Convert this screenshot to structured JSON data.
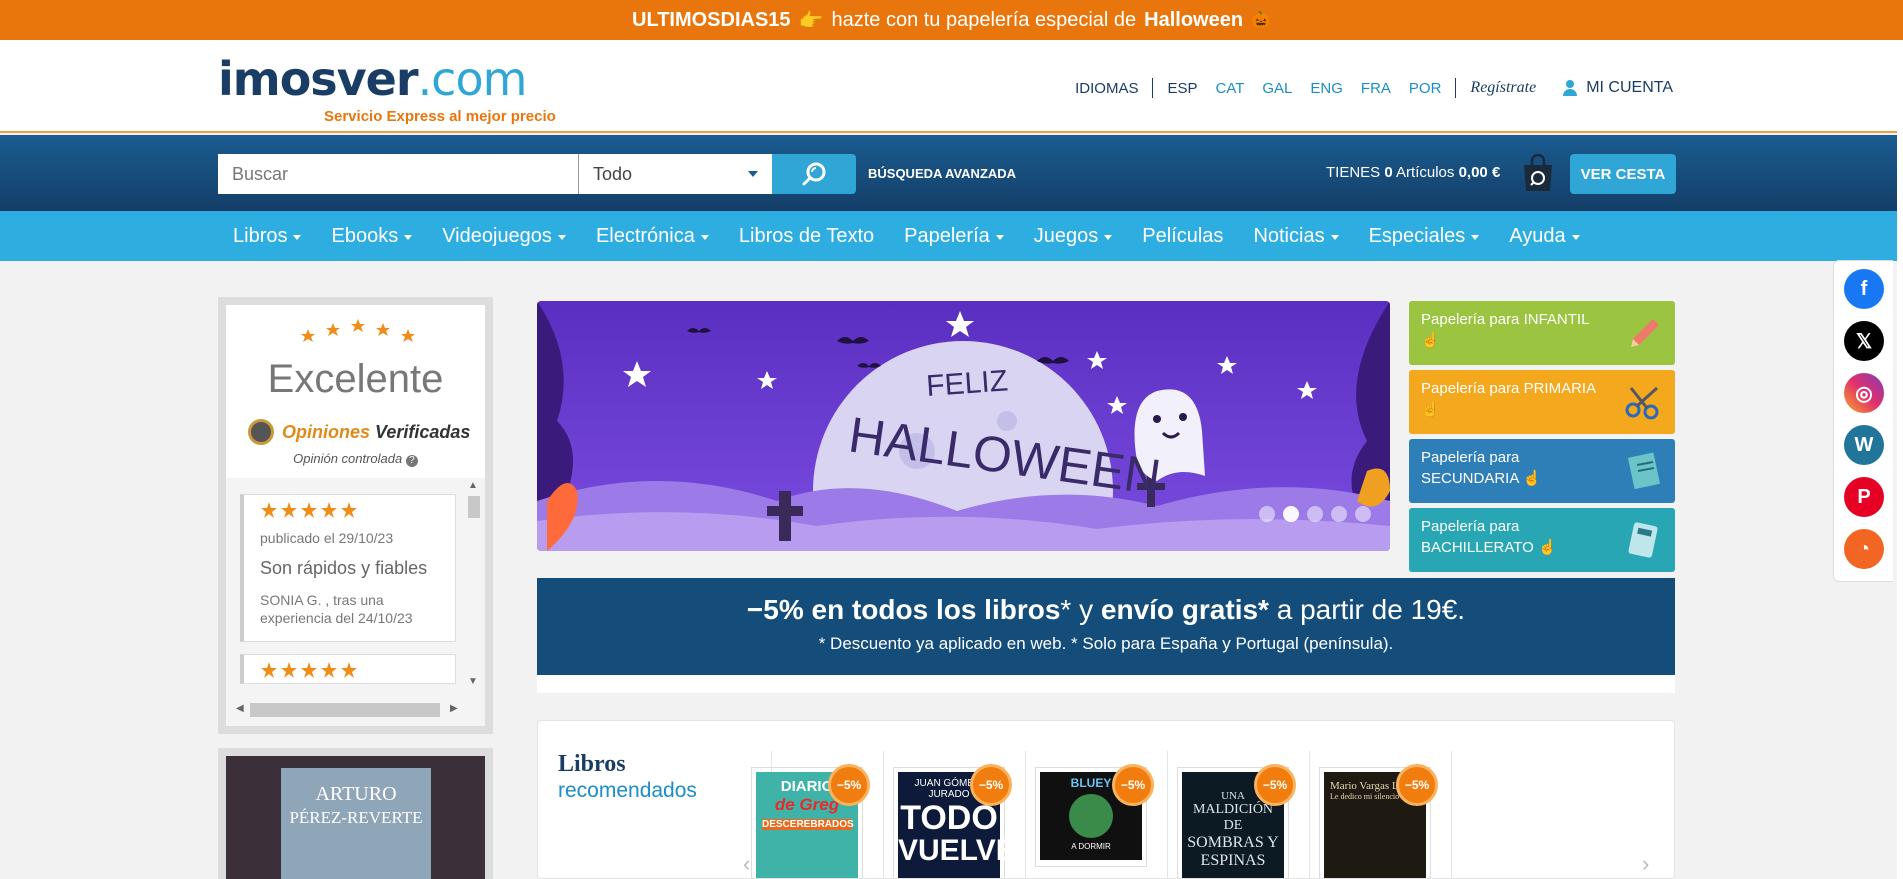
{
  "promo": {
    "code": "ULTIMOSDIAS15",
    "hand": "👉",
    "text": "hazte con tu papelería especial de",
    "highlight": "Halloween",
    "emoji": "🎃"
  },
  "header": {
    "logo_main": "imosver",
    "logo_tld": ".com",
    "logo_tagline": "Servicio Express al mejor precio",
    "languages_label": "IDIOMAS",
    "languages": [
      "ESP",
      "CAT",
      "GAL",
      "ENG",
      "FRA",
      "POR"
    ],
    "register": "Regístrate",
    "account": "MI CUENTA"
  },
  "search": {
    "placeholder": "Buscar",
    "category": "Todo",
    "advanced": "BÚSQUEDA AVANZADA",
    "cart_prefix": "TIENES",
    "cart_count": "0",
    "cart_items_label": "Artículos",
    "cart_total": "0,00 €",
    "cart_button": "VER CESTA"
  },
  "nav": [
    {
      "label": "Libros",
      "dropdown": true
    },
    {
      "label": "Ebooks",
      "dropdown": true
    },
    {
      "label": "Videojuegos",
      "dropdown": true
    },
    {
      "label": "Electrónica",
      "dropdown": true
    },
    {
      "label": "Libros de Texto",
      "dropdown": false
    },
    {
      "label": "Papelería",
      "dropdown": true
    },
    {
      "label": "Juegos",
      "dropdown": true
    },
    {
      "label": "Películas",
      "dropdown": false
    },
    {
      "label": "Noticias",
      "dropdown": true
    },
    {
      "label": "Especiales",
      "dropdown": true
    },
    {
      "label": "Ayuda",
      "dropdown": true
    }
  ],
  "reviews": {
    "rating_label": "Excelente",
    "brand_a": "Opiniones",
    "brand_b": "Verificadas",
    "controlled": "Opinión controlada",
    "stars": 5,
    "card": {
      "date": "publicado el 29/10/23",
      "text": "Son rápidos y fiables",
      "author_line1": "SONIA G. , tras una",
      "author_line2": "experiencia del 24/10/23"
    }
  },
  "book_promo": {
    "line1": "ARTURO",
    "line2": "PÉREZ-REVERTE"
  },
  "hero": {
    "line1": "FELIZ",
    "line2": "HALLOWEEN",
    "slides": 5,
    "active_slide": 2
  },
  "tiles": [
    {
      "line1": "Papelería para INFANTIL",
      "line2": "",
      "color": "#9bc441",
      "icon": "pencil-icon"
    },
    {
      "line1": "Papelería para PRIMARIA",
      "line2": "",
      "color": "#f3a81e",
      "icon": "scissors-icon"
    },
    {
      "line1": "Papelería para",
      "line2": "SECUNDARIA",
      "color": "#2e7fb8",
      "icon": "notebook-icon"
    },
    {
      "line1": "Papelería para",
      "line2": "BACHILLERATO",
      "color": "#28a6b4",
      "icon": "calculator-icon"
    }
  ],
  "discount": {
    "bold1": "−5% en todos los libros",
    "star1": "*",
    "mid": " y ",
    "bold2": "envío gratis*",
    "rest": " a partir de 19€.",
    "note": "* Descuento ya aplicado en web. * Solo para España y Portugal (península)."
  },
  "books_section": {
    "title": "Libros",
    "subtitle": "recomendados",
    "badge": "−5%",
    "items": [
      {
        "title_a": "DIARIO",
        "title_b": "de Greg",
        "title_c": "DESCEREBRADOS",
        "bg": "#3fb3a8"
      },
      {
        "title_a": "JUAN GÓMEZ-JURADO",
        "title_b": "TODO",
        "title_c": "VUELVE",
        "bg": "#0d1a3a"
      },
      {
        "title_a": "BLUEY",
        "title_b": "A DORMIR",
        "title_c": "",
        "bg": "#101010"
      },
      {
        "title_a": "UNA",
        "title_b": "MALDICIÓN DE",
        "title_c": "SOMBRAS Y ESPINAS",
        "bg": "#0c1a24"
      },
      {
        "title_a": "Mario Vargas Llosa",
        "title_b": "Le dedico mi silencio",
        "title_c": "",
        "bg": "#1e1a12"
      }
    ]
  },
  "social": [
    {
      "name": "facebook-icon",
      "glyph": "f",
      "color": "#1877f2"
    },
    {
      "name": "x-icon",
      "glyph": "𝕏",
      "color": "#000000"
    },
    {
      "name": "instagram-icon",
      "glyph": "◎",
      "color": "#e1306c"
    },
    {
      "name": "wordpress-icon",
      "glyph": "W",
      "color": "#21759b"
    },
    {
      "name": "pinterest-icon",
      "glyph": "P",
      "color": "#e60023"
    },
    {
      "name": "rss-icon",
      "glyph": "◔",
      "color": "#f26522"
    }
  ]
}
